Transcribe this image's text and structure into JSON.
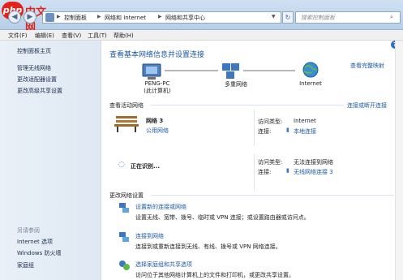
{
  "logo": {
    "badge": "php",
    "text": "中文网"
  },
  "address": {
    "crumbs": [
      "控制面板",
      "网络和 Internet",
      "网络和共享中心"
    ],
    "search_placeholder": "搜索控制面板"
  },
  "menu": [
    "文件(F)",
    "编辑(E)",
    "查看(V)",
    "工具(T)",
    "帮助(H)"
  ],
  "sidebar": {
    "items": [
      "控制面板主页",
      "管理无线网络",
      "更改适配器设置",
      "更改高级共享设置"
    ],
    "see_also": "另请参阅",
    "see_items": [
      "Internet 选项",
      "Windows 防火墙",
      "家庭组"
    ]
  },
  "main": {
    "title": "查看基本网络信息并设置连接",
    "full_map": "查看完整映射",
    "nodes": [
      {
        "label1": "PENG-PC",
        "label2": "(此计算机)"
      },
      {
        "label1": "多重网络",
        "label2": ""
      },
      {
        "label1": "Internet",
        "label2": ""
      }
    ],
    "active_title": "查看活动网络",
    "connect_link": "连接或断开连接",
    "net1": {
      "name": "网络  3",
      "type": "公用网络",
      "access_label": "访问类型:",
      "access_value": "Internet",
      "conn_label": "连接:",
      "conn_value": "本地连接"
    },
    "net2": {
      "name": "正在识别...",
      "access_label": "访问类型:",
      "access_value": "无法连接到网络",
      "conn_label": "连接:",
      "conn_value": "无线网络连接 3"
    },
    "change_title": "更改网络设置",
    "tasks": [
      {
        "title": "设置新的连接或网络",
        "desc": "设置无线、宽带、拨号、临时或 VPN 连接；或设置路由器或访问点。"
      },
      {
        "title": "连接到网络",
        "desc": "连接到或重新连接到无线、有线、拨号或 VPN 网络连接。"
      },
      {
        "title": "选择家庭组和共享选项",
        "desc": "访问位于其他网络计算机上的文件和打印机，或更改共享设置。"
      }
    ]
  }
}
